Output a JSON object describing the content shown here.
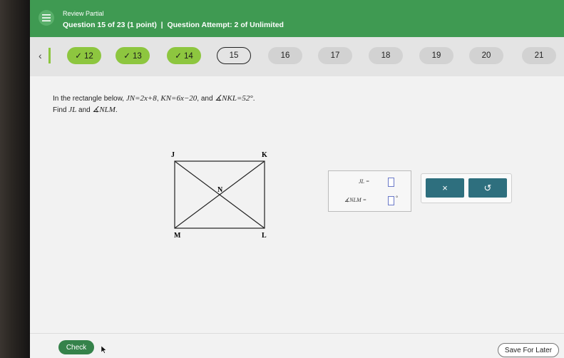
{
  "header": {
    "status": "Review Partial",
    "question_info": "Question 15 of 23 (1 point)  |  Question Attempt: 2 of Unlimited"
  },
  "nav": {
    "back_icon": "chevron-left-icon",
    "questions": [
      {
        "label": "✓ 12",
        "state": "done"
      },
      {
        "label": "✓ 13",
        "state": "done"
      },
      {
        "label": "✓ 14",
        "state": "done"
      },
      {
        "label": "15",
        "state": "current"
      },
      {
        "label": "16",
        "state": "todo"
      },
      {
        "label": "17",
        "state": "todo"
      },
      {
        "label": "18",
        "state": "todo"
      },
      {
        "label": "19",
        "state": "todo"
      },
      {
        "label": "20",
        "state": "todo"
      },
      {
        "label": "21",
        "state": "todo"
      }
    ]
  },
  "problem": {
    "intro": "In the rectangle below,",
    "jn": "JN=2x+8",
    "comma1": ",",
    "kn": "KN=6x−20",
    "and": ", and",
    "angle": "∡NKL=52°",
    "period": ".",
    "find": "Find",
    "jl": "JL",
    "find_and": "and",
    "nlm": "∡NLM",
    "period2": "."
  },
  "figure": {
    "labels": {
      "J": "J",
      "K": "K",
      "M": "M",
      "L": "L",
      "N": "N"
    }
  },
  "answers": {
    "jl_label": "JL =",
    "nlm_label": "∡NLM =",
    "degree": "°"
  },
  "tools": {
    "clear_label": "×",
    "undo_label": "↺"
  },
  "footer": {
    "check_label": "Check",
    "save_label": "Save For Later"
  },
  "colors": {
    "header_green": "#3f9a52",
    "done_green": "#8dc63f",
    "tool_teal": "#2e6f7e"
  }
}
